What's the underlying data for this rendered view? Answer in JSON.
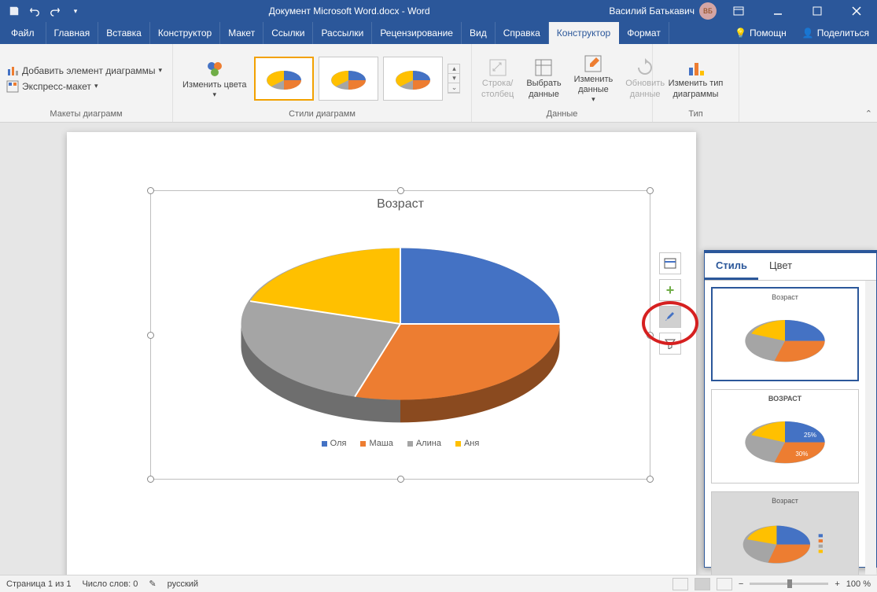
{
  "title": {
    "doc": "Документ Microsoft Word.docx",
    "app": "Word",
    "sep": "  -  "
  },
  "user": {
    "name": "Василий Батькавич",
    "initials": "ВБ"
  },
  "tabs": {
    "file": "Файл",
    "items": [
      "Главная",
      "Вставка",
      "Конструктор",
      "Макет",
      "Ссылки",
      "Рассылки",
      "Рецензирование",
      "Вид",
      "Справка",
      "Конструктор",
      "Формат"
    ],
    "active_index": 9,
    "help": "Помощн",
    "share": "Поделиться"
  },
  "ribbon": {
    "groups": {
      "layouts": {
        "label": "Макеты диаграмм",
        "add_element": "Добавить элемент диаграммы",
        "quick_layout": "Экспресс-макет"
      },
      "styles": {
        "label": "Стили диаграмм",
        "change_colors": "Изменить цвета"
      },
      "data": {
        "label": "Данные",
        "switch": "Строка/\nстолбец",
        "select": "Выбрать\nданные",
        "edit": "Изменить\nданные",
        "refresh": "Обновить\nданные"
      },
      "type": {
        "label": "Тип",
        "change_type": "Изменить тип\nдиаграммы"
      }
    }
  },
  "chart_data": {
    "type": "pie",
    "title": "Возраст",
    "categories": [
      "Оля",
      "Маша",
      "Алина",
      "Аня"
    ],
    "values": [
      25,
      30,
      25,
      20
    ],
    "colors": [
      "#4472c4",
      "#ed7d31",
      "#a5a5a5",
      "#ffc000"
    ]
  },
  "float": {
    "layout": "layout",
    "plus": "+",
    "brush": "brush",
    "filter": "filter"
  },
  "flyout": {
    "tab_style": "Стиль",
    "tab_color": "Цвет",
    "thumb_title1": "Возраст",
    "thumb_title2": "ВОЗРАСТ",
    "thumb_title3": "Возраст"
  },
  "status": {
    "page": "Страница 1 из 1",
    "words": "Число слов: 0",
    "lang": "русский",
    "zoom": "100 %",
    "minus": "−",
    "plus": "+"
  }
}
